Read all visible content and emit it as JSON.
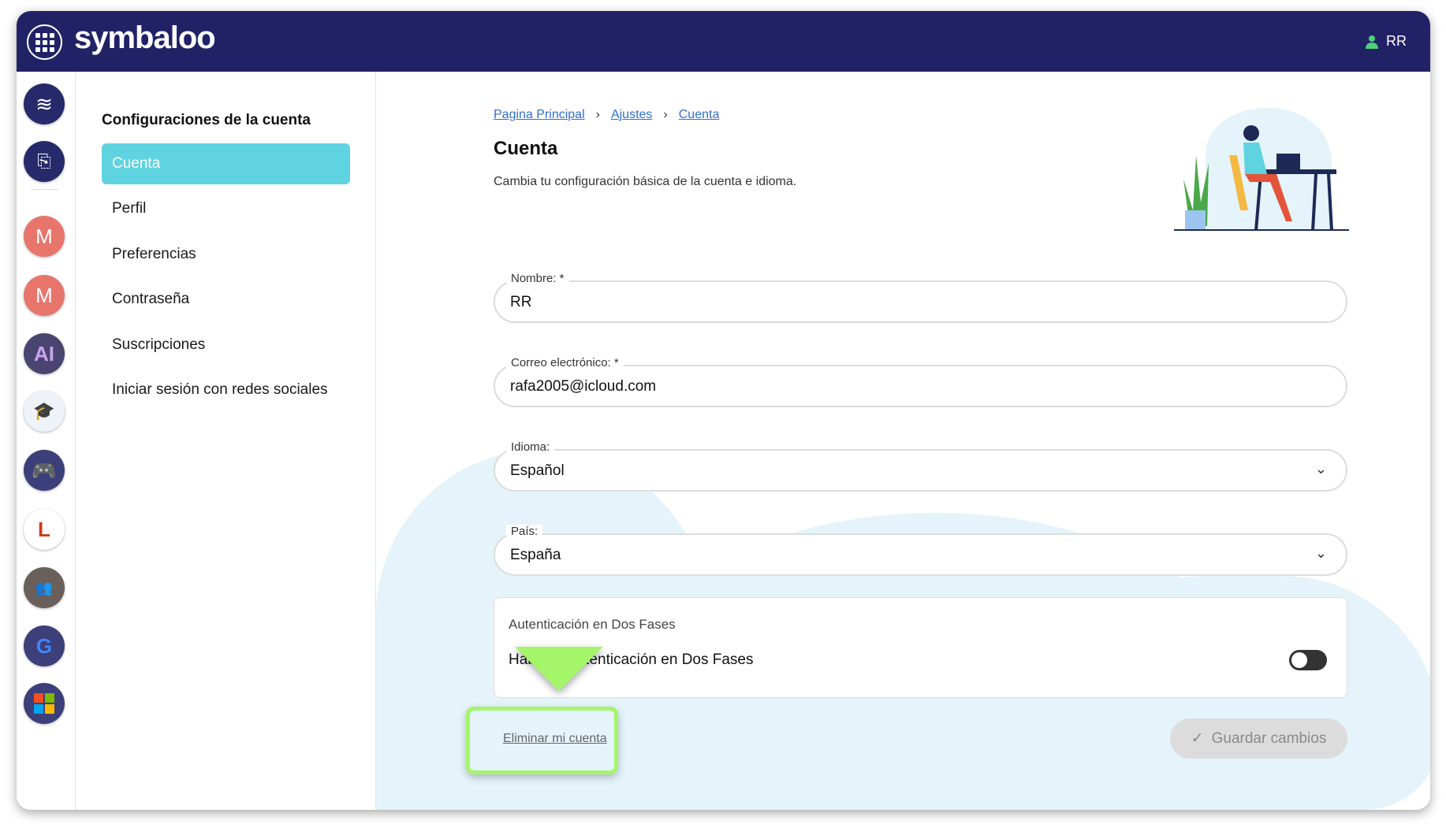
{
  "header": {
    "logo": "symbaloo",
    "user": "RR"
  },
  "rail": {
    "items": [
      "layers",
      "search-doc",
      "M",
      "M",
      "AI",
      "graduates",
      "gamepad",
      "LL",
      "group-photo",
      "google",
      "microsoft"
    ]
  },
  "sidebar": {
    "title": "Configuraciones de la cuenta",
    "items": [
      {
        "label": "Cuenta",
        "active": true
      },
      {
        "label": "Perfil"
      },
      {
        "label": "Preferencias"
      },
      {
        "label": "Contraseña"
      },
      {
        "label": "Suscripciones"
      },
      {
        "label": "Iniciar sesión con redes sociales"
      }
    ]
  },
  "breadcrumb": [
    "Pagina Principal",
    "Ajustes",
    "Cuenta"
  ],
  "page": {
    "title": "Cuenta",
    "subtitle": "Cambia tu configuración básica de la cuenta e idioma."
  },
  "form": {
    "name": {
      "label": "Nombre: *",
      "value": "RR"
    },
    "email": {
      "label": "Correo electrónico: *",
      "value": "rafa2005@icloud.com"
    },
    "language": {
      "label": "Idioma:",
      "value": "Español"
    },
    "country": {
      "label": "País:",
      "value": "España"
    }
  },
  "auth": {
    "title": "Autenticación en Dos Fases",
    "row": "Habilitar Autenticación en Dos Fases",
    "enabled": false
  },
  "actions": {
    "delete": "Eliminar mi cuenta",
    "save": "Guardar cambios"
  },
  "colors": {
    "header": "#212266",
    "active": "#5fd3e0",
    "highlight": "#a4f56a"
  }
}
